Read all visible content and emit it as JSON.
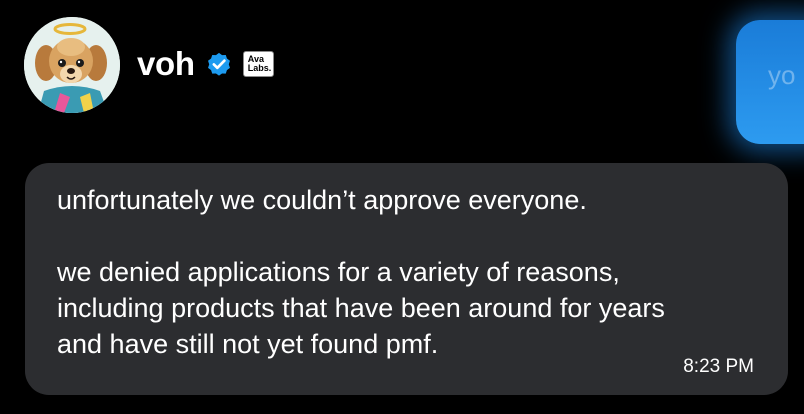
{
  "sender": {
    "display_name": "voh",
    "verified": true,
    "affiliate_badge": [
      "Ava",
      "Labs."
    ]
  },
  "sent_message": {
    "text": "yo"
  },
  "received_message": {
    "lines": [
      "unfortunately we couldn’t approve everyone.",
      "we denied applications for a variety of reasons,",
      "including products that have been around for years",
      "and have still not yet found pmf."
    ],
    "timestamp": "8:23 PM"
  },
  "colors": {
    "background": "#000000",
    "bubble_received": "#2c2d30",
    "bubble_sent": "#1d9bf0",
    "verified_badge": "#1d9bf0"
  },
  "icons": {
    "verified": "verified-check-icon",
    "avatar": "dog-with-halo-avatar"
  }
}
